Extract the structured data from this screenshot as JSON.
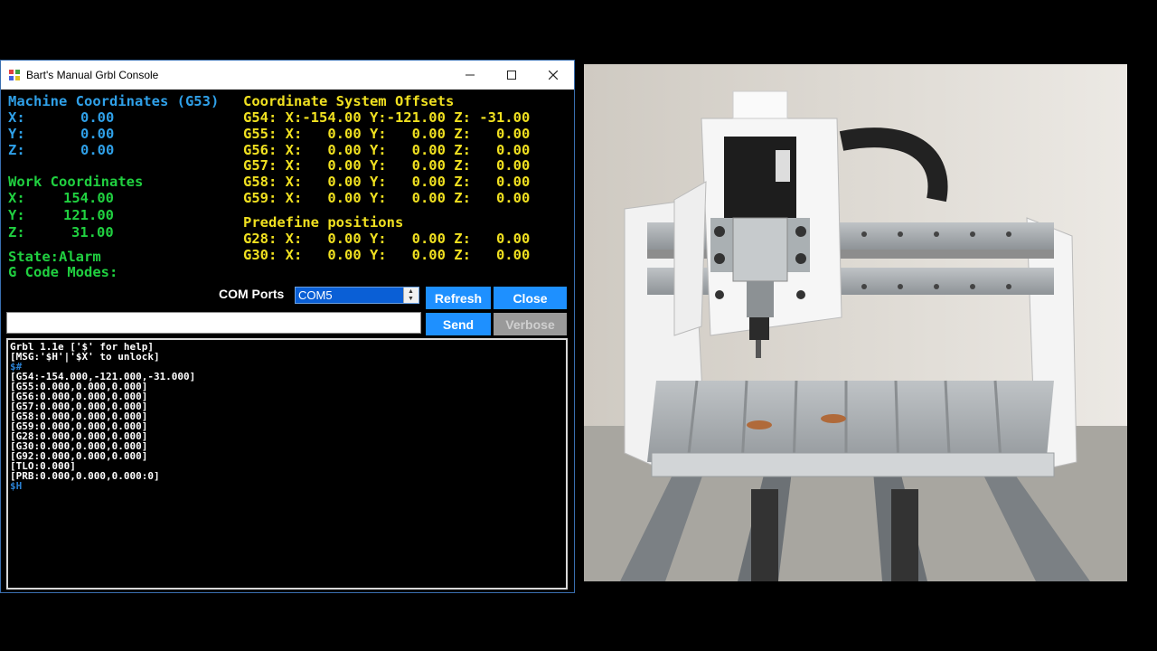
{
  "window": {
    "title": "Bart's Manual Grbl Console"
  },
  "machine": {
    "heading": "Machine Coordinates (G53)",
    "rows": [
      {
        "label": "X:",
        "value": "0.00"
      },
      {
        "label": "Y:",
        "value": "0.00"
      },
      {
        "label": "Z:",
        "value": "0.00"
      }
    ]
  },
  "work": {
    "heading": "Work Coordinates",
    "rows": [
      {
        "label": "X:",
        "value": "154.00"
      },
      {
        "label": "Y:",
        "value": "121.00"
      },
      {
        "label": "Z:",
        "value": "31.00"
      }
    ]
  },
  "state_text": "State:Alarm",
  "gcode_modes_label": "G Code Modes:",
  "offsets": {
    "heading": "Coordinate System Offsets",
    "rows": [
      "G54: X:-154.00 Y:-121.00 Z: -31.00",
      "G55: X:   0.00 Y:   0.00 Z:   0.00",
      "G56: X:   0.00 Y:   0.00 Z:   0.00",
      "G57: X:   0.00 Y:   0.00 Z:   0.00",
      "G58: X:   0.00 Y:   0.00 Z:   0.00",
      "G59: X:   0.00 Y:   0.00 Z:   0.00"
    ]
  },
  "predefined": {
    "heading": "Predefine positions",
    "rows": [
      "G28: X:   0.00 Y:   0.00 Z:   0.00",
      "G30: X:   0.00 Y:   0.00 Z:   0.00"
    ]
  },
  "com": {
    "label": "COM Ports",
    "selected": "COM5"
  },
  "buttons": {
    "refresh": "Refresh",
    "close": "Close",
    "send": "Send",
    "verbose": "Verbose"
  },
  "command_input": {
    "value": ""
  },
  "console_lines": [
    {
      "text": "Grbl 1.1e ['$' for help]",
      "cmd": false
    },
    {
      "text": "[MSG:'$H'|'$X' to unlock]",
      "cmd": false
    },
    {
      "text": "$#",
      "cmd": true
    },
    {
      "text": "[G54:-154.000,-121.000,-31.000]",
      "cmd": false
    },
    {
      "text": "[G55:0.000,0.000,0.000]",
      "cmd": false
    },
    {
      "text": "[G56:0.000,0.000,0.000]",
      "cmd": false
    },
    {
      "text": "[G57:0.000,0.000,0.000]",
      "cmd": false
    },
    {
      "text": "[G58:0.000,0.000,0.000]",
      "cmd": false
    },
    {
      "text": "[G59:0.000,0.000,0.000]",
      "cmd": false
    },
    {
      "text": "[G28:0.000,0.000,0.000]",
      "cmd": false
    },
    {
      "text": "[G30:0.000,0.000,0.000]",
      "cmd": false
    },
    {
      "text": "[G92:0.000,0.000,0.000]",
      "cmd": false
    },
    {
      "text": "[TLO:0.000]",
      "cmd": false
    },
    {
      "text": "[PRB:0.000,0.000,0.000:0]",
      "cmd": false
    },
    {
      "text": "$H",
      "cmd": true
    }
  ],
  "colors": {
    "heading_cyan": "#2fa0e8",
    "heading_green": "#20d040",
    "text_yellow": "#f0e020",
    "button_blue": "#1e90ff",
    "button_disabled": "#9a9a9a"
  }
}
